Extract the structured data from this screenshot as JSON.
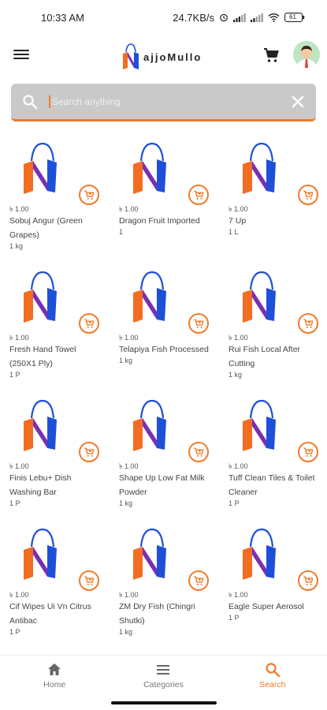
{
  "status_bar": {
    "time": "10:33 AM",
    "network_speed": "24.7KB/s",
    "battery": "61"
  },
  "header": {
    "brand": "ajjoMullo",
    "logo_icon": "najjomullo-bag-logo",
    "menu_icon": "hamburger-menu-icon",
    "cart_icon": "cart-icon",
    "avatar_icon": "user-avatar"
  },
  "search": {
    "placeholder": "Search anything",
    "value": ""
  },
  "colors": {
    "accent": "#f07b2a",
    "logo_orange": "#f26d21",
    "logo_purple": "#7a2fb3",
    "logo_blue": "#1e4fd8"
  },
  "products": [
    {
      "price": "৳ 1.00",
      "name": "Sobuj Angur (Green Grapes)",
      "unit": "1 kg"
    },
    {
      "price": "৳ 1.00",
      "name": "Dragon Fruit Imported",
      "unit": "1"
    },
    {
      "price": "৳ 1.00",
      "name": "7 Up",
      "unit": "1 L"
    },
    {
      "price": "৳ 1.00",
      "name": "Fresh Hand Towel (250X1 Ply)",
      "unit": "1 P"
    },
    {
      "price": "৳ 1.00",
      "name": "Telapiya Fish Processed",
      "unit": "1 kg"
    },
    {
      "price": "৳ 1.00",
      "name": "Rui Fish Local After Cutting",
      "unit": "1 kg"
    },
    {
      "price": "৳ 1.00",
      "name": "Finis Lebu+ Dish Washing Bar",
      "unit": "1 P"
    },
    {
      "price": "৳ 1.00",
      "name": "Shape Up Low Fat Milk Powder",
      "unit": "1 kg"
    },
    {
      "price": "৳ 1.00",
      "name": "Tuff Clean Tiles & Toilet Cleaner",
      "unit": "1 P"
    },
    {
      "price": "৳ 1.00",
      "name": "Cif Wipes Ui Vn Citrus Antibac",
      "unit": "1 P"
    },
    {
      "price": "৳ 1.00",
      "name": "ZM Dry Fish (Chingri Shutki)",
      "unit": "1 kg"
    },
    {
      "price": "৳ 1.00",
      "name": "Eagle Super Aerosol",
      "unit": "1 P"
    }
  ],
  "bottom_nav": [
    {
      "label": "Home",
      "icon": "home-icon",
      "active": false
    },
    {
      "label": "Categories",
      "icon": "categories-icon",
      "active": false
    },
    {
      "label": "Search",
      "icon": "search-icon",
      "active": true
    }
  ]
}
